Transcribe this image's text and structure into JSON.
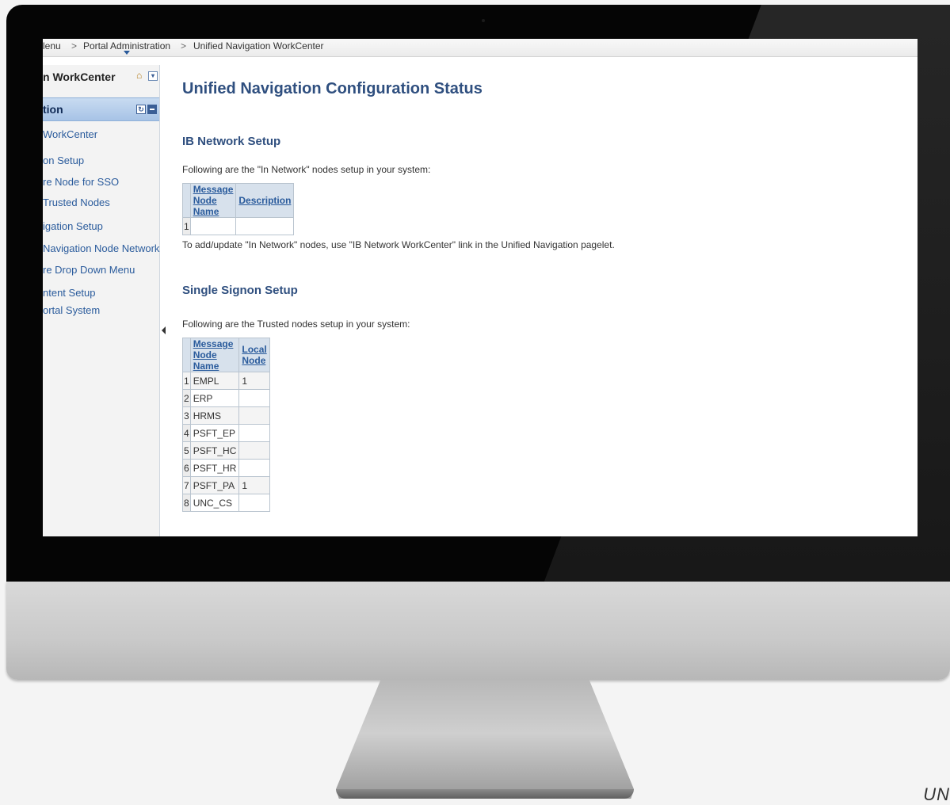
{
  "breadcrumb": {
    "items": [
      "lenu",
      "Portal Administration",
      "Unified Navigation WorkCenter"
    ],
    "separator": ">"
  },
  "sidebar": {
    "title": "n WorkCenter",
    "header": "tion",
    "items": [
      "WorkCenter",
      "on Setup",
      "re Node for SSO",
      "Trusted Nodes",
      "igation Setup",
      "Navigation Node Network",
      "re Drop Down Menu",
      "ntent Setup",
      "ortal System"
    ]
  },
  "main": {
    "title": "Unified Navigation Configuration Status",
    "ib_section": {
      "title": "IB Network Setup",
      "intro": "Following are the \"In Network\" nodes setup in your system:",
      "columns": [
        "Message Node Name",
        "Description"
      ],
      "rows": [
        {
          "num": "1",
          "name": "",
          "desc": ""
        }
      ],
      "note": "To add/update \"In Network\" nodes, use \"IB Network WorkCenter\" link in the Unified Navigation pagelet."
    },
    "sso_section": {
      "title": "Single Signon Setup",
      "intro": "Following are the Trusted nodes setup in your system:",
      "columns": [
        "Message Node Name",
        "Local Node"
      ],
      "rows": [
        {
          "num": "1",
          "name": "EMPL",
          "local": "1"
        },
        {
          "num": "2",
          "name": "ERP",
          "local": ""
        },
        {
          "num": "3",
          "name": "HRMS",
          "local": ""
        },
        {
          "num": "4",
          "name": "PSFT_EP",
          "local": ""
        },
        {
          "num": "5",
          "name": "PSFT_HC",
          "local": ""
        },
        {
          "num": "6",
          "name": "PSFT_HR",
          "local": ""
        },
        {
          "num": "7",
          "name": "PSFT_PA",
          "local": "1"
        },
        {
          "num": "8",
          "name": "UNC_CS",
          "local": ""
        }
      ]
    }
  },
  "corner_text": "UN",
  "colors": {
    "title_blue": "#2f4f7f",
    "link_blue": "#2a5b9c",
    "header_band": "#a7c3e6"
  }
}
